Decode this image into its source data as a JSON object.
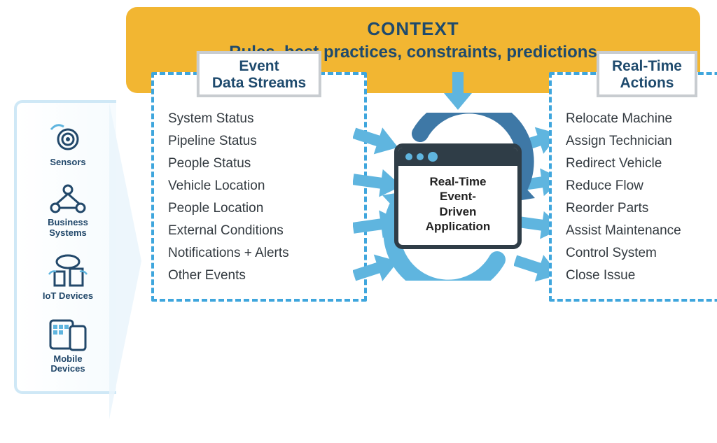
{
  "context": {
    "title": "CONTEXT",
    "subtitle": "Rules, best practices, constraints, predictions"
  },
  "sources": {
    "items": [
      {
        "label": "Sensors"
      },
      {
        "label": "Business\nSystems"
      },
      {
        "label": "IoT Devices"
      },
      {
        "label": "Mobile\nDevices"
      }
    ]
  },
  "left_panel": {
    "title": "Event\nData Streams",
    "items": [
      "System Status",
      "Pipeline Status",
      "People Status",
      "Vehicle Location",
      "People Location",
      "External Conditions",
      "Notifications + Alerts",
      "Other Events"
    ]
  },
  "center": {
    "app_label": "Real-Time\nEvent-\nDriven\nApplication"
  },
  "right_panel": {
    "title": "Real-Time\nActions",
    "items": [
      "Relocate Machine",
      "Assign Technician",
      "Redirect Vehicle",
      "Reduce Flow",
      "Reorder Parts",
      "Assist Maintenance",
      "Control System",
      "Close Issue"
    ]
  }
}
